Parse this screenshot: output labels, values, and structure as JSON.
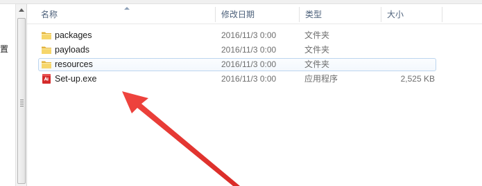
{
  "nav": {
    "partial_label": "位置"
  },
  "columns": {
    "name": "名称",
    "date": "修改日期",
    "type": "类型",
    "size": "大小"
  },
  "files": [
    {
      "name": "packages",
      "date": "2016/11/3 0:00",
      "type": "文件夹",
      "size": "",
      "icon": "folder-icon"
    },
    {
      "name": "payloads",
      "date": "2016/11/3 0:00",
      "type": "文件夹",
      "size": "",
      "icon": "folder-icon"
    },
    {
      "name": "resources",
      "date": "2016/11/3 0:00",
      "type": "文件夹",
      "size": "",
      "icon": "folder-icon",
      "selected": true
    },
    {
      "name": "Set-up.exe",
      "date": "2016/11/3 0:00",
      "type": "应用程序",
      "size": "2,525 KB",
      "icon": "adobe-setup-icon"
    }
  ],
  "colors": {
    "header_text": "#4c607a",
    "selection_border": "#bcd5ef",
    "arrow": "#e8322e",
    "folder": "#f2c94c"
  }
}
